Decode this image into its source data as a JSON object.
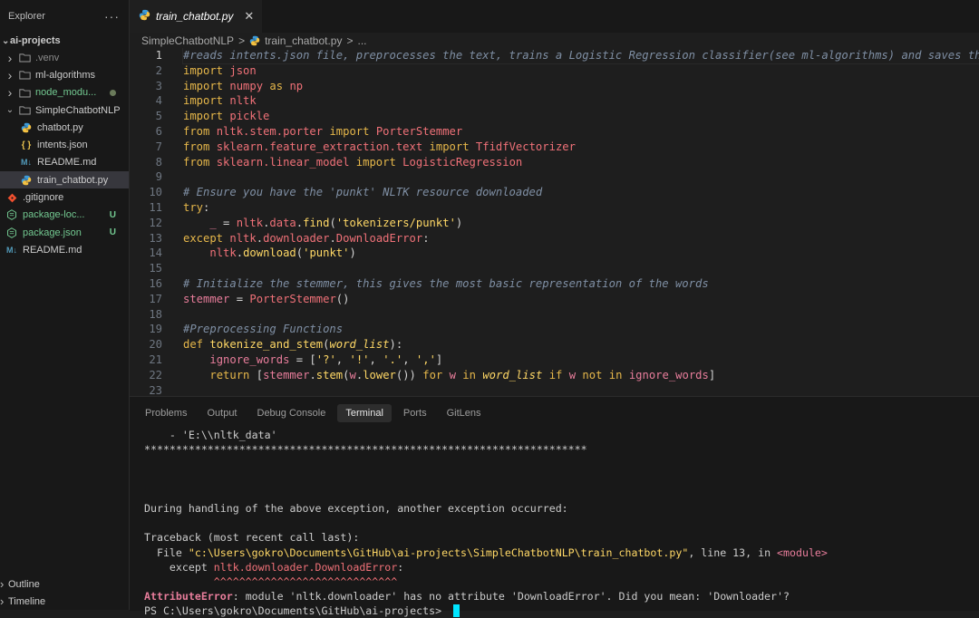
{
  "sidebar": {
    "title": "Explorer",
    "more_label": "···",
    "root": "ai-projects",
    "items": [
      {
        "label": ".venv",
        "kind": "folder",
        "depth": 1,
        "style": "dim"
      },
      {
        "label": "ml-algorithms",
        "kind": "folder",
        "depth": 1,
        "style": "normal"
      },
      {
        "label": "node_modu...",
        "kind": "folder",
        "depth": 1,
        "style": "green",
        "dot": true
      },
      {
        "label": "SimpleChatbotNLP",
        "kind": "folder-open",
        "depth": 1,
        "style": "normal"
      },
      {
        "label": "chatbot.py",
        "kind": "py",
        "depth": 2,
        "style": "normal"
      },
      {
        "label": "intents.json",
        "kind": "json",
        "depth": 2,
        "style": "normal"
      },
      {
        "label": "README.md",
        "kind": "md",
        "depth": 2,
        "style": "normal"
      },
      {
        "label": "train_chatbot.py",
        "kind": "py",
        "depth": 2,
        "style": "normal",
        "active": true
      },
      {
        "label": ".gitignore",
        "kind": "git",
        "depth": 1,
        "style": "normal"
      },
      {
        "label": "package-loc...",
        "kind": "pkg",
        "depth": 1,
        "style": "green",
        "badge": "U"
      },
      {
        "label": "package.json",
        "kind": "pkg",
        "depth": 1,
        "style": "green",
        "badge": "U"
      },
      {
        "label": "README.md",
        "kind": "md",
        "depth": 1,
        "style": "normal"
      }
    ],
    "footer": [
      {
        "label": "Outline"
      },
      {
        "label": "Timeline"
      }
    ]
  },
  "editor": {
    "tab_label": "train_chatbot.py",
    "close_symbol": "✕",
    "breadcrumb": [
      "SimpleChatbotNLP",
      "train_chatbot.py",
      "..."
    ],
    "breadcrumb_sep": ">",
    "current_line": 1,
    "lines": [
      [
        [
          "cmt",
          "#reads intents.json file, preprocesses the text, trains a Logistic Regression classifier(see ml-algorithms) and saves the trained"
        ]
      ],
      [
        [
          "kw",
          "import"
        ],
        [
          "plain",
          " "
        ],
        [
          "mod",
          "json"
        ]
      ],
      [
        [
          "kw",
          "import"
        ],
        [
          "plain",
          " "
        ],
        [
          "mod",
          "numpy"
        ],
        [
          "plain",
          " "
        ],
        [
          "kw",
          "as"
        ],
        [
          "plain",
          " "
        ],
        [
          "mod",
          "np"
        ]
      ],
      [
        [
          "kw",
          "import"
        ],
        [
          "plain",
          " "
        ],
        [
          "mod",
          "nltk"
        ]
      ],
      [
        [
          "kw",
          "import"
        ],
        [
          "plain",
          " "
        ],
        [
          "mod",
          "pickle"
        ]
      ],
      [
        [
          "kw",
          "from"
        ],
        [
          "plain",
          " "
        ],
        [
          "mod",
          "nltk.stem.porter"
        ],
        [
          "plain",
          " "
        ],
        [
          "kw",
          "import"
        ],
        [
          "plain",
          " "
        ],
        [
          "mod",
          "PorterStemmer"
        ]
      ],
      [
        [
          "kw",
          "from"
        ],
        [
          "plain",
          " "
        ],
        [
          "mod",
          "sklearn.feature_extraction.text"
        ],
        [
          "plain",
          " "
        ],
        [
          "kw",
          "import"
        ],
        [
          "plain",
          " "
        ],
        [
          "mod",
          "TfidfVectorizer"
        ]
      ],
      [
        [
          "kw",
          "from"
        ],
        [
          "plain",
          " "
        ],
        [
          "mod",
          "sklearn.linear_model"
        ],
        [
          "plain",
          " "
        ],
        [
          "kw",
          "import"
        ],
        [
          "plain",
          " "
        ],
        [
          "mod",
          "LogisticRegression"
        ]
      ],
      [],
      [
        [
          "cmt",
          "# Ensure you have the 'punkt' NLTK resource downloaded"
        ]
      ],
      [
        [
          "kw",
          "try"
        ],
        [
          "plain",
          ":"
        ]
      ],
      [
        [
          "plain",
          "    "
        ],
        [
          "var",
          "_"
        ],
        [
          "plain",
          " = "
        ],
        [
          "mod",
          "nltk"
        ],
        [
          "plain",
          "."
        ],
        [
          "mod",
          "data"
        ],
        [
          "plain",
          "."
        ],
        [
          "fn",
          "find"
        ],
        [
          "plain",
          "("
        ],
        [
          "str",
          "'tokenizers/punkt'"
        ],
        [
          "plain",
          ")"
        ]
      ],
      [
        [
          "kw",
          "except"
        ],
        [
          "plain",
          " "
        ],
        [
          "mod",
          "nltk"
        ],
        [
          "plain",
          "."
        ],
        [
          "mod",
          "downloader"
        ],
        [
          "plain",
          "."
        ],
        [
          "mod",
          "DownloadError"
        ],
        [
          "plain",
          ":"
        ]
      ],
      [
        [
          "plain",
          "    "
        ],
        [
          "mod",
          "nltk"
        ],
        [
          "plain",
          "."
        ],
        [
          "fn",
          "download"
        ],
        [
          "plain",
          "("
        ],
        [
          "str",
          "'punkt'"
        ],
        [
          "plain",
          ")"
        ]
      ],
      [],
      [
        [
          "cmt",
          "# Initialize the stemmer, this gives the most basic representation of the words"
        ]
      ],
      [
        [
          "var",
          "stemmer"
        ],
        [
          "plain",
          " = "
        ],
        [
          "mod",
          "PorterStemmer"
        ],
        [
          "plain",
          "()"
        ]
      ],
      [],
      [
        [
          "cmt",
          "#Preprocessing Functions"
        ]
      ],
      [
        [
          "kw",
          "def"
        ],
        [
          "plain",
          " "
        ],
        [
          "fn",
          "tokenize_and_stem"
        ],
        [
          "plain",
          "("
        ],
        [
          "param",
          "word_list"
        ],
        [
          "plain",
          "):"
        ]
      ],
      [
        [
          "plain",
          "    "
        ],
        [
          "var",
          "ignore_words"
        ],
        [
          "plain",
          " = ["
        ],
        [
          "str",
          "'?'"
        ],
        [
          "plain",
          ", "
        ],
        [
          "str",
          "'!'"
        ],
        [
          "plain",
          ", "
        ],
        [
          "str",
          "'.'"
        ],
        [
          "plain",
          ", "
        ],
        [
          "str",
          "','"
        ],
        [
          "plain",
          "]"
        ]
      ],
      [
        [
          "plain",
          "    "
        ],
        [
          "kw",
          "return"
        ],
        [
          "plain",
          " ["
        ],
        [
          "var",
          "stemmer"
        ],
        [
          "plain",
          "."
        ],
        [
          "fn",
          "stem"
        ],
        [
          "plain",
          "("
        ],
        [
          "var",
          "w"
        ],
        [
          "plain",
          "."
        ],
        [
          "fn",
          "lower"
        ],
        [
          "plain",
          "()) "
        ],
        [
          "kw",
          "for"
        ],
        [
          "plain",
          " "
        ],
        [
          "var",
          "w"
        ],
        [
          "plain",
          " "
        ],
        [
          "kw",
          "in"
        ],
        [
          "plain",
          " "
        ],
        [
          "param",
          "word_list"
        ],
        [
          "plain",
          " "
        ],
        [
          "kw",
          "if"
        ],
        [
          "plain",
          " "
        ],
        [
          "var",
          "w"
        ],
        [
          "plain",
          " "
        ],
        [
          "kw",
          "not"
        ],
        [
          "plain",
          " "
        ],
        [
          "kw",
          "in"
        ],
        [
          "plain",
          " "
        ],
        [
          "var",
          "ignore_words"
        ],
        [
          "plain",
          "]"
        ]
      ],
      []
    ]
  },
  "panel": {
    "tabs": [
      {
        "label": "Problems"
      },
      {
        "label": "Output"
      },
      {
        "label": "Debug Console"
      },
      {
        "label": "Terminal",
        "active": true
      },
      {
        "label": "Ports"
      },
      {
        "label": "GitLens"
      }
    ],
    "terminal": [
      [
        [
          "plain",
          "    - 'E:\\\\nltk_data'"
        ]
      ],
      [
        [
          "plain",
          "**********************************************************************"
        ]
      ],
      [],
      [],
      [],
      [
        [
          "plain",
          "During handling of the above exception, another exception occurred:"
        ]
      ],
      [],
      [
        [
          "plain",
          "Traceback (most recent call last):"
        ]
      ],
      [
        [
          "plain",
          "  File "
        ],
        [
          "str",
          "\"c:\\Users\\gokro\\Documents\\GitHub\\ai-projects\\SimpleChatbotNLP\\train_chatbot.py\""
        ],
        [
          "plain",
          ", line 13, in "
        ],
        [
          "mod",
          "<module>"
        ]
      ],
      [
        [
          "plain",
          "    except "
        ],
        [
          "err",
          "nltk.downloader.DownloadError"
        ],
        [
          "plain",
          ":"
        ]
      ],
      [
        [
          "carets",
          "           ^^^^^^^^^^^^^^^^^^^^^^^^^^^^^"
        ]
      ],
      [
        [
          "errname",
          "AttributeError"
        ],
        [
          "plain",
          ": module 'nltk.downloader' has no attribute 'DownloadError'. Did you mean: 'Downloader'?"
        ]
      ],
      [
        [
          "plain",
          "PS C:\\Users\\gokro\\Documents\\GitHub\\ai-projects> "
        ],
        [
          "cursor",
          ""
        ]
      ]
    ]
  },
  "colors": {
    "accent": "#0078d4",
    "python_icon": "#4fc1ff",
    "git_icon": "#f1502f",
    "untracked": "#73c991",
    "terminal_cursor": "#00e5ff"
  }
}
